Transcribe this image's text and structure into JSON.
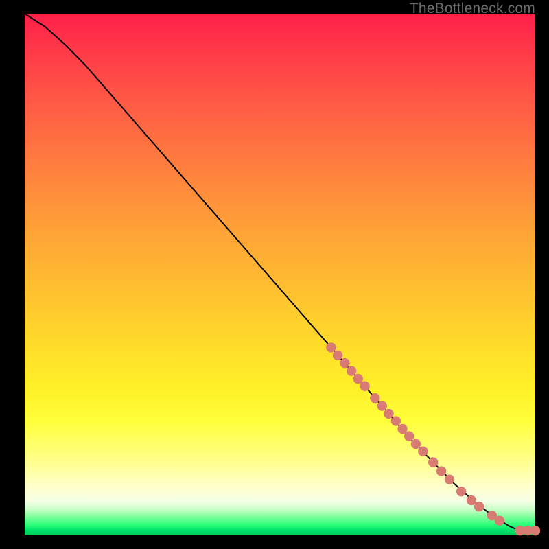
{
  "watermark": "TheBottleneck.com",
  "colors": {
    "line": "#000000",
    "marker_fill": "#d77b73",
    "marker_stroke": "#d77b73"
  },
  "chart_data": {
    "type": "line",
    "title": "",
    "xlabel": "",
    "ylabel": "",
    "xlim": [
      0,
      100
    ],
    "ylim": [
      0,
      100
    ],
    "grid": false,
    "legend": false,
    "series": [
      {
        "name": "curve",
        "kind": "line",
        "x": [
          0,
          4,
          8,
          12,
          16,
          20,
          24,
          28,
          32,
          36,
          40,
          44,
          48,
          52,
          56,
          60,
          64,
          68,
          72,
          76,
          80,
          84,
          88,
          92,
          95,
          97,
          100
        ],
        "y": [
          100,
          97.5,
          94,
          90,
          85.5,
          81,
          76.5,
          72,
          67.5,
          63,
          58.5,
          54,
          49.5,
          45,
          40.5,
          36,
          31.5,
          27,
          22.5,
          18,
          14,
          10,
          6.5,
          3.5,
          1.7,
          0.9,
          0.9
        ]
      },
      {
        "name": "markers",
        "kind": "scatter",
        "points": [
          {
            "x": 60.0,
            "y": 36.0
          },
          {
            "x": 61.3,
            "y": 34.5
          },
          {
            "x": 62.7,
            "y": 33.0
          },
          {
            "x": 64.0,
            "y": 31.5
          },
          {
            "x": 65.3,
            "y": 30.0
          },
          {
            "x": 66.6,
            "y": 28.6
          },
          {
            "x": 68.6,
            "y": 26.3
          },
          {
            "x": 70.0,
            "y": 24.8
          },
          {
            "x": 71.3,
            "y": 23.3
          },
          {
            "x": 72.7,
            "y": 21.9
          },
          {
            "x": 74.0,
            "y": 20.4
          },
          {
            "x": 75.3,
            "y": 19.0
          },
          {
            "x": 76.6,
            "y": 17.5
          },
          {
            "x": 78.0,
            "y": 16.1
          },
          {
            "x": 80.0,
            "y": 14.0
          },
          {
            "x": 81.6,
            "y": 12.3
          },
          {
            "x": 83.2,
            "y": 10.7
          },
          {
            "x": 85.5,
            "y": 8.4
          },
          {
            "x": 87.5,
            "y": 6.7
          },
          {
            "x": 89.0,
            "y": 5.5
          },
          {
            "x": 91.5,
            "y": 3.8
          },
          {
            "x": 93.0,
            "y": 2.8
          },
          {
            "x": 97.0,
            "y": 0.9
          },
          {
            "x": 98.5,
            "y": 0.9
          },
          {
            "x": 100.0,
            "y": 0.9
          }
        ]
      }
    ]
  }
}
